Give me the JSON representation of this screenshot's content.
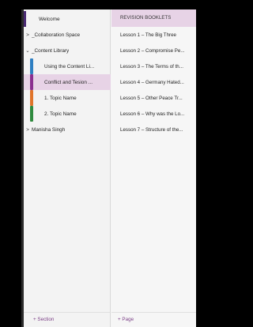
{
  "sections": {
    "items": [
      {
        "label": "Welcome",
        "chevron": "",
        "color": "#4a2a73",
        "selected": false
      },
      {
        "label": "_Collaboration Space",
        "chevron": ">",
        "color": "",
        "selected": false
      },
      {
        "label": "_Content Library",
        "chevron": "⌄",
        "color": "",
        "selected": false
      },
      {
        "label": "Using the Content Li...",
        "chevron": "",
        "color": "#2e7fc2",
        "selected": false
      },
      {
        "label": "Conflict and Tesion ...",
        "chevron": "",
        "color": "#8a2e8f",
        "selected": true
      },
      {
        "label": "1. Topic Name",
        "chevron": "",
        "color": "#e0742a",
        "selected": false
      },
      {
        "label": "2. Topic Name",
        "chevron": "",
        "color": "#2f8a3e",
        "selected": false
      },
      {
        "label": "Manisha Singh",
        "chevron": ">",
        "color": "",
        "selected": false
      }
    ],
    "add_label": "+ Section"
  },
  "pages": {
    "header": "REVISION BOOKLETS",
    "items": [
      "Lesson 1 – The Big Three",
      "Lesson 2 – Compromise Pe...",
      "Lesson 3 – The Terms of th...",
      "Lesson 4 – Germany Hated...",
      "Lesson 5 – Other Peace Tr...",
      "Lesson 6 – Why was the Lo...",
      "Lesson 7 – Structure of the..."
    ],
    "add_label": "+ Page"
  },
  "colors": {
    "accent": "#7b3f86",
    "selected_bg": "#e7d3e6"
  }
}
